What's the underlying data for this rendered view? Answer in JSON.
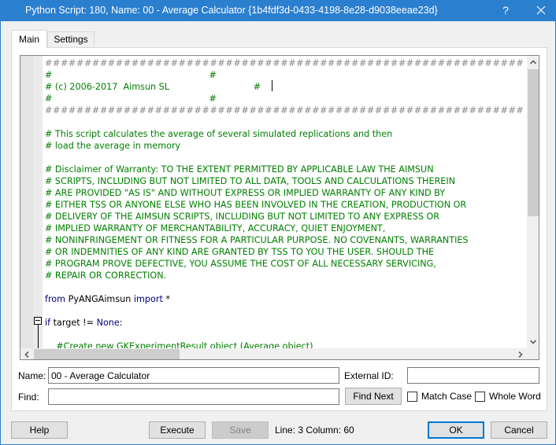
{
  "window": {
    "title": "Python Script: 180, Name: 00 - Average Calculator  {1b4fdf3d-0433-4198-8e28-d9038eeae23d}",
    "help_glyph": "?",
    "close_icon": "close-icon"
  },
  "tabs": [
    {
      "label": "Main",
      "active": true
    },
    {
      "label": "Settings",
      "active": false
    }
  ],
  "editor": {
    "lines": [
      {
        "type": "hash",
        "text": "#############################################################"
      },
      {
        "type": "comment",
        "text": "#                                                        #"
      },
      {
        "type": "comment",
        "text": "# (c) 2006-2017  Aimsun SL                              #"
      },
      {
        "type": "comment",
        "text": "#                                                        #"
      },
      {
        "type": "hash",
        "text": "#############################################################"
      },
      {
        "type": "blank",
        "text": ""
      },
      {
        "type": "comment",
        "text": "# This script calculates the average of several simulated replications and then"
      },
      {
        "type": "comment",
        "text": "# load the average in memory"
      },
      {
        "type": "blank",
        "text": ""
      },
      {
        "type": "comment",
        "text": "# Disclaimer of Warranty: TO THE EXTENT PERMITTED BY APPLICABLE LAW THE AIMSUN"
      },
      {
        "type": "comment",
        "text": "# SCRIPTS, INCLUDING BUT NOT LIMITED TO ALL DATA, TOOLS AND CALCULATIONS THEREIN"
      },
      {
        "type": "comment",
        "text": "# ARE PROVIDED \"AS IS\" AND WITHOUT EXPRESS OR IMPLIED WARRANTY OF ANY KIND BY"
      },
      {
        "type": "comment",
        "text": "# EITHER TSS OR ANYONE ELSE WHO HAS BEEN INVOLVED IN THE CREATION, PRODUCTION OR"
      },
      {
        "type": "comment",
        "text": "# DELIVERY OF THE AIMSUN SCRIPTS, INCLUDING BUT NOT LIMITED TO ANY EXPRESS OR"
      },
      {
        "type": "comment",
        "text": "# IMPLIED WARRANTY OF MERCHANTABILITY, ACCURACY, QUIET ENJOYMENT,"
      },
      {
        "type": "comment",
        "text": "# NONINFRINGEMENT OR FITNESS FOR A PARTICULAR PURPOSE. NO COVENANTS, WARRANTIES"
      },
      {
        "type": "comment",
        "text": "# OR INDEMNITIES OF ANY KIND ARE GRANTED BY TSS TO YOU THE USER. SHOULD THE"
      },
      {
        "type": "comment",
        "text": "# PROGRAM PROVE DEFECTIVE, YOU ASSUME THE COST OF ALL NECESSARY SERVICING,"
      },
      {
        "type": "comment",
        "text": "# REPAIR OR CORRECTION."
      },
      {
        "type": "blank",
        "text": ""
      },
      {
        "type": "code",
        "tokens": [
          {
            "t": "kw",
            "text": "from"
          },
          {
            "t": "plain",
            "text": " PyANGAimsun "
          },
          {
            "t": "kw",
            "text": "import"
          },
          {
            "t": "plain",
            "text": " *"
          }
        ]
      },
      {
        "type": "blank",
        "text": ""
      },
      {
        "type": "code",
        "tokens": [
          {
            "t": "kw",
            "text": "if"
          },
          {
            "t": "plain",
            "text": " target != "
          },
          {
            "t": "kw",
            "text": "None"
          },
          {
            "t": "plain",
            "text": ":"
          }
        ]
      },
      {
        "type": "blank",
        "text": ""
      },
      {
        "type": "comment",
        "text": "    #Create new GKExperimentResult object (Average object)"
      }
    ],
    "colors": {
      "comment": "#007f00",
      "hash": "#8a8a8a",
      "keyword": "#00007f",
      "plain": "#000000"
    },
    "scroll_up_icon": "chevron-up-icon",
    "scroll_down_icon": "chevron-down-icon",
    "scroll_left_icon": "chevron-left-icon",
    "scroll_right_icon": "chevron-right-icon"
  },
  "fields": {
    "name_label": "Name:",
    "name_value": "00 - Average Calculator",
    "external_id_label": "External ID:",
    "external_id_value": "",
    "find_label": "Find:",
    "find_value": "",
    "find_next_label": "Find Next",
    "match_case_label": "Match Case",
    "match_case_checked": false,
    "whole_word_label": "Whole Word",
    "whole_word_checked": false
  },
  "footer": {
    "help_label": "Help",
    "execute_label": "Execute",
    "save_label": "Save",
    "save_enabled": false,
    "status_text": "Line: 3  Column: 60",
    "ok_label": "OK",
    "cancel_label": "Cancel"
  },
  "theme": {
    "titlebar_color": "#2b7fcf",
    "focus_border": "#0078d7"
  }
}
